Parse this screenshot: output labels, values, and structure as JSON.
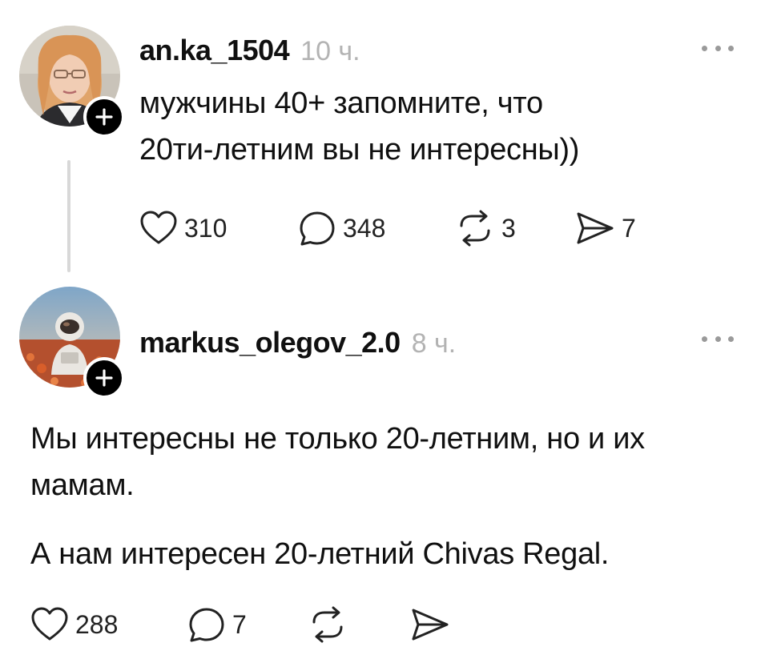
{
  "posts": [
    {
      "username": "an.ka_1504",
      "time": "10 ч.",
      "text_lines": [
        "мужчины 40+ запомните, что",
        "20ти-летним вы не интересны))"
      ],
      "likes": "310",
      "comments": "348",
      "reposts": "3",
      "shares": "7",
      "avatar_icon": "woman-portrait-avatar",
      "follow_icon": "plus-icon"
    },
    {
      "username": "markus_olegov_2.0",
      "time": "8 ч.",
      "paragraphs": [
        "Мы интересны не только 20-летним, но и их мамам.",
        "А нам интересен 20-летний Chivas Regal."
      ],
      "likes": "288",
      "comments": "7",
      "avatar_icon": "astronaut-in-flower-field-avatar",
      "follow_icon": "plus-icon"
    }
  ],
  "colors": {
    "text": "#101010",
    "muted": "#b3b3b3",
    "thread_line": "#d8d8d8",
    "badge": "#000000"
  }
}
